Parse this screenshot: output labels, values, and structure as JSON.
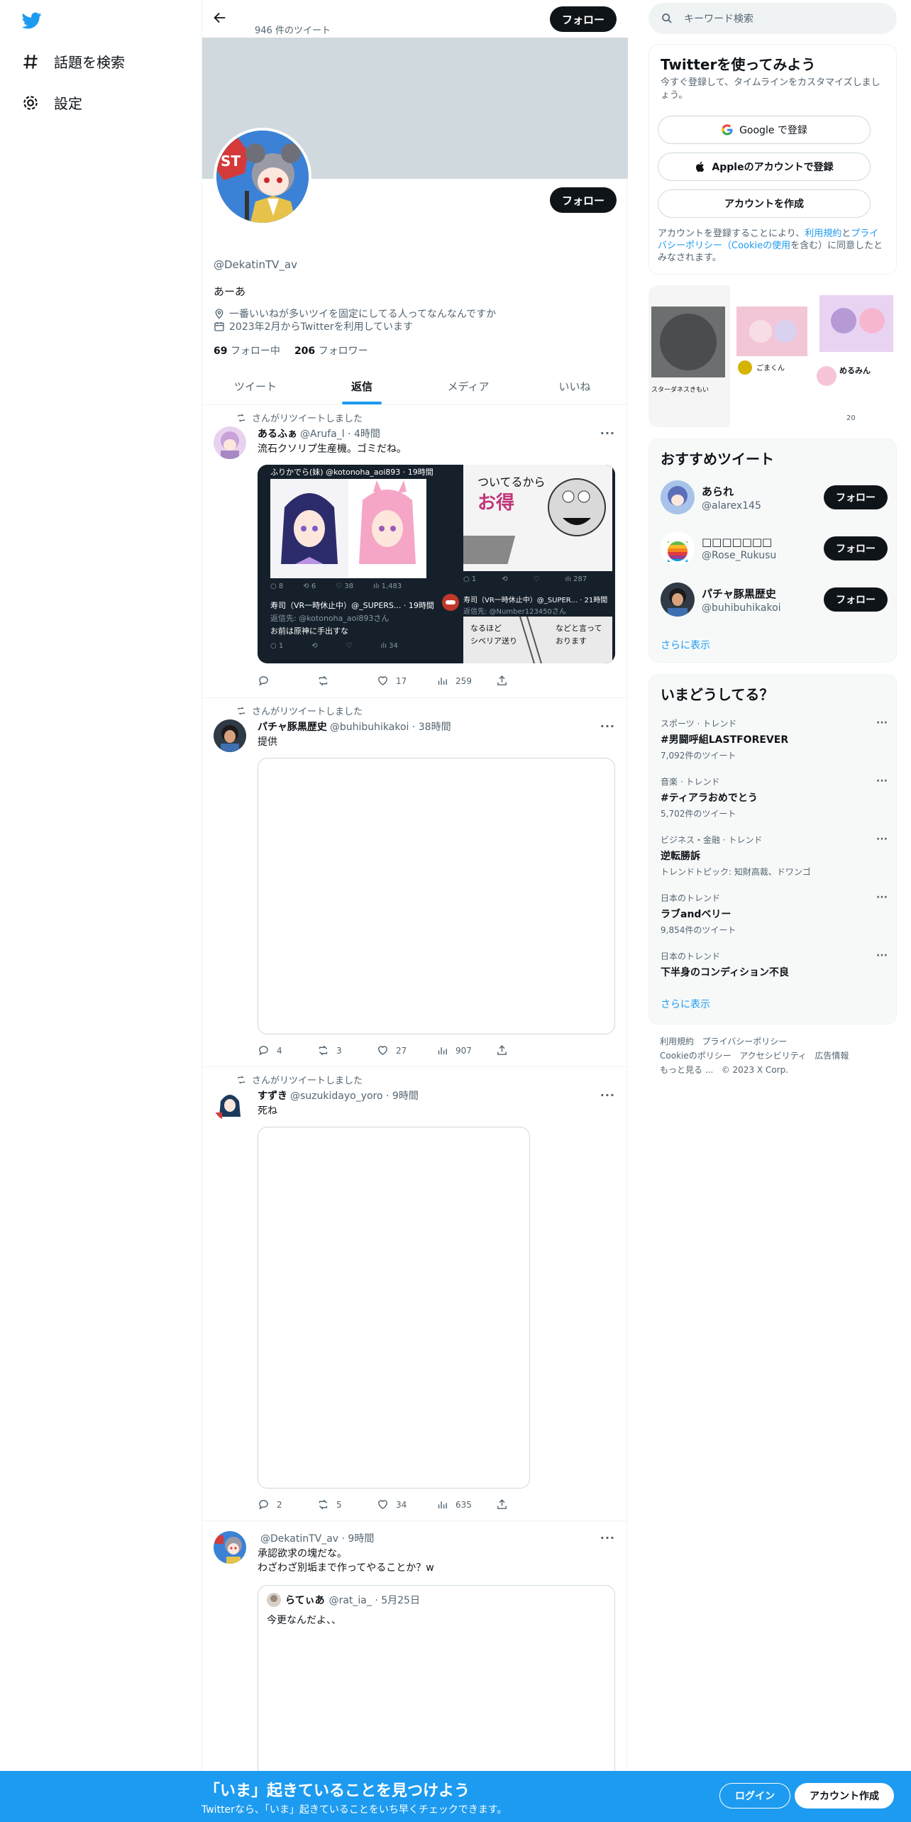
{
  "nav": {
    "explore": "話題を検索",
    "settings": "設定"
  },
  "profile": {
    "tweet_count": "946 件のツイート",
    "follow_label": "フォロー",
    "handle": "@DekatinTV_av",
    "bio": "あーあ",
    "pinned_note": "一番いいねが多いツイを固定にしてる人ってなんなんですか",
    "joined": "2023年2月からTwitterを利用しています",
    "following_count": "69",
    "following_label": "フォロー中",
    "followers_count": "206",
    "followers_label": "フォロワー",
    "tabs": [
      "ツイート",
      "返信",
      "メディア",
      "いいね"
    ]
  },
  "tweets": [
    {
      "rt_label": "さんがリツイートしました",
      "name": "あるふぁ",
      "sub": "@Arufa_l · 4時間",
      "text": "流石クソリプ生産機。ゴミだね。",
      "media_left_header": "ふりかでら(妹) @kotonoha_aoi893 · 19時間",
      "media_left_footer_name": "寿司（VR一時休止中）@_SUPERS... · 19時間",
      "media_left_footer_reply": "返信先: @kotonoha_aoi893さん",
      "media_left_footer_text": "お前は原神に手出すな",
      "media_right_header": "ついてるから お得",
      "media_right_footer_name": "寿司（VR一時休止中）@_SUPER... · 21時間",
      "media_right_footer_reply": "返信先: @Number123450さん",
      "replies": "",
      "retweets": "",
      "likes": "17",
      "views": "259"
    },
    {
      "rt_label": "さんがリツイートしました",
      "name": "パチャ豚黒歴史",
      "sub": "@buhibuhikakoi · 38時間",
      "text": "提供",
      "replies": "4",
      "retweets": "3",
      "likes": "27",
      "views": "907"
    },
    {
      "rt_label": "さんがリツイートしました",
      "name": "すずき",
      "sub": "@suzukidayo_yoro · 9時間",
      "text": "死ね",
      "replies": "2",
      "retweets": "5",
      "likes": "34",
      "views": "635"
    },
    {
      "name": "",
      "sub": "@DekatinTV_av · 9時間",
      "text": "承認欲求の塊だな。\nわざわざ別垢まで作ってやることか？w",
      "quote_name": "らてぃあ",
      "quote_sub": "@rat_ia_ · 5月25日",
      "quote_text": "今更なんだよ、、"
    }
  ],
  "right": {
    "search_placeholder": "キーワード検索",
    "signup_title": "Twitterを使ってみよう",
    "signup_sub": "今すぐ登録して、タイムラインをカスタマイズしましょう。",
    "google_btn": "Google で登録",
    "apple_btn": "Appleのアカウントで登録",
    "create_btn": "アカウントを作成",
    "terms_pre": "アカウントを登録することにより、",
    "terms_link": "利用規約",
    "terms_and": "と",
    "privacy_link": "プライバシーポリシー（Cookieの使用",
    "terms_post": "を含む）に同意したとみなされます。",
    "media_strip_label1": "スターダネスきもい",
    "media_strip_label2": "ごまくん",
    "media_strip_label3": "めるみん",
    "media_strip_count": "20",
    "recommend_title": "おすすめツイート",
    "suggestions": [
      {
        "name": "あられ",
        "handle": "@alarex145"
      },
      {
        "name": "□□□□□□□",
        "handle": "@Rose_Rukusu"
      },
      {
        "name": "パチャ豚黒歴史",
        "handle": "@buhibuhikakoi"
      }
    ],
    "show_more": "さらに表示",
    "trends_title": "いまどうしてる？",
    "trends": [
      {
        "cat": "スポーツ · トレンド",
        "name": "#男闘呼組LASTFOREVER",
        "count": "7,092件のツイート"
      },
      {
        "cat": "音楽 · トレンド",
        "name": "#ティアラおめでとう",
        "count": "5,702件のツイート"
      },
      {
        "cat": "ビジネス・金融 · トレンド",
        "name": "逆転勝訴",
        "count": "トレンドトピック: 知財高裁、ドワンゴ"
      },
      {
        "cat": "日本のトレンド",
        "name": "ラブandベリー",
        "count": "9,854件のツイート"
      },
      {
        "cat": "日本のトレンド",
        "name": "下半身のコンディション不良",
        "count": ""
      }
    ],
    "footer": [
      "利用規約",
      "プライバシーポリシー",
      "Cookieのポリシー",
      "アクセシビリティ",
      "広告情報",
      "もっと見る ...",
      "© 2023 X Corp."
    ]
  },
  "bottom": {
    "title": "「いま」起きていることを見つけよう",
    "sub": "Twitterなら、「いま」起きていることをいち早くチェックできます。",
    "login": "ログイン",
    "create": "アカウント作成"
  },
  "colors": {
    "accent": "#1d9bf0",
    "banner": "#cfd9de",
    "dark": "#0f1419"
  }
}
